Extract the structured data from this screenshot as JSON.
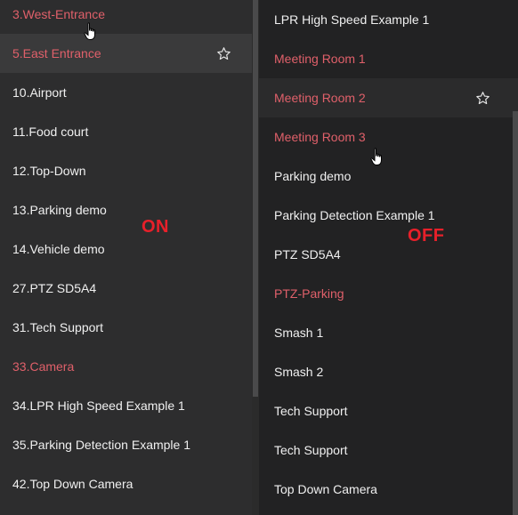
{
  "left_list": {
    "items": [
      {
        "label": "3.West-Entrance",
        "highlight": true
      },
      {
        "label": "5.East Entrance",
        "highlight": true,
        "hover": true,
        "star": true
      },
      {
        "label": "10.Airport"
      },
      {
        "label": "11.Food court"
      },
      {
        "label": "12.Top-Down"
      },
      {
        "label": "13.Parking demo"
      },
      {
        "label": "14.Vehicle demo"
      },
      {
        "label": "27.PTZ SD5A4"
      },
      {
        "label": "31.Tech Support"
      },
      {
        "label": "33.Camera",
        "highlight": true
      },
      {
        "label": "34.LPR High Speed Example 1"
      },
      {
        "label": "35.Parking Detection Example 1"
      },
      {
        "label": "42.Top Down Camera"
      }
    ]
  },
  "right_list": {
    "items": [
      {
        "label": "LPR High Speed Example 1"
      },
      {
        "label": "Meeting Room 1",
        "highlight": true
      },
      {
        "label": "Meeting Room 2",
        "highlight": true,
        "hover": true,
        "star": true
      },
      {
        "label": "Meeting Room 3",
        "highlight": true
      },
      {
        "label": "Parking demo"
      },
      {
        "label": "Parking Detection Example 1"
      },
      {
        "label": "PTZ SD5A4"
      },
      {
        "label": "PTZ-Parking",
        "highlight": true
      },
      {
        "label": "Smash 1"
      },
      {
        "label": "Smash 2"
      },
      {
        "label": "Tech Support"
      },
      {
        "label": "Tech Support"
      },
      {
        "label": "Top Down Camera"
      }
    ]
  },
  "annotations": {
    "on": "ON",
    "off": "OFF"
  },
  "icons": {
    "star": "star-outline-icon",
    "cursor": "hand-pointer-icon"
  },
  "colors": {
    "highlight_text": "#e0606a",
    "annotation_red": "#e8202a",
    "text": "#f0f0f0"
  }
}
